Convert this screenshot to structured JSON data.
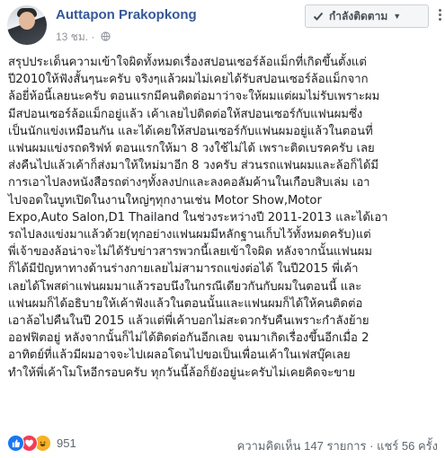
{
  "post": {
    "author": "Auttapon Prakopkong",
    "time": "13 ชม.",
    "privacy_icon": "globe-icon",
    "follow_label": "กำลังติดตาม",
    "body": "สรุปประเด็นความเข้าใจผิดทั้งหมดเรื่องสปอนเซอร์ล้อแม็กที่เกิดขึ้นตั้งแต่\nปี2010ให้ฟังสั้นๆนะครับ จริงๆแล้วผมไม่เคยได้รับสปอนเซอร์ล้อแม็กจาก\nล้อยี่ห้อนี้เลยนะครับ ตอนแรกมีคนติดต่อมาว่าจะให้ผมแต่ผมไม่รับเพราะผม\nมีสปอนเซอร์ล้อแม็กอยู่แล้ว เค้าเลยไปติดต่อให้สปอนเซอร์กับแฟนผมซึ่ง\nเป็นนักแข่งเหมือนกัน และได้เคยให้สปอนเซอร์กับแฟนผมอยู่แล้วในตอนที่\nแฟนผมแข่งรถดริฟท์ ตอนแรกให้มา 8 วงใช้ไม่ได้ เพราะติดเบรคครับ เลย\nส่งคืนไปแล้วเค้าก็ส่งมาให้ใหม่มาอีก 8 วงครับ ส่วนรถแฟนผมและล้อก็ได้มี\nการเอาไปลงหนังสือรถต่างๆทั้งลงปกและลงคอลัมค้านในเกือบสิบเล่ม เอา\nไปจอดในบูทเปิดในงานใหญ่ๆทุกงานเช่น Motor Show,Motor\nExpo,Auto Salon,D1 Thailand ในช่วงระหว่างปี 2011-2013 และได้เอา\nรถไปลงแข่งมาแล้วด้วย(ทุกอย่างแฟนผมมีหลักฐานเก็บไว้ทั้งหมดครับ)แต่\nพี่เจ้าของล้อน่าจะไม่ได้รับข่าวสารพวกนี้เลยเข้าใจผิด หลังจากนั้นแฟนผม\nก็ได้มีปัญหาทางด้านร่างกายเลยไม่สามารถแข่งต่อได้ ในปี2015 พี่เค้า\nเลยได้โพสด่าแฟนผมมาแล้วรอบนึงในกรณีเดียวกันกับผมในตอนนี้ และ\nแฟนผมก็ได้อธิบายให้เค้าฟังแล้วในตอนนั้นและแฟนผมก็ได้ให้คนติดต่อ\nเอาล้อไปคืนในปี 2015 แล้วแต่พี่เค้าบอกไม่สะดวกรับคืนเพราะกำลังย้าย\nออฟฟิตอยู่ หลังจากนั้นก็ไม่ได้ติดต่อกันอีกเลย จนมาเกิดเรื่องขึ้นอีกเมื่อ 2\nอาทิตย์ที่แล้วมีผมอาจจะไปเผลอโดนไปขอเป็นเพื่อนเค้าในเฟสบุ๊คเลย\nทำให้พี่เค้าโมโหอีกรอบครับ ทุกวันนี้ล้อก็ยังอยู่นะครับไม่เคยคิดจะขาย"
  },
  "reactions": {
    "types": [
      "like",
      "love",
      "haha"
    ],
    "count": "951"
  },
  "stats": {
    "comments": "ความคิดเห็น 147 รายการ",
    "shares": "แชร์ 56 ครั้ง"
  },
  "colors": {
    "author": "#365899",
    "meta": "#90949c",
    "like": "#1877f2",
    "love": "#f33e58",
    "haha": "#f7b125"
  }
}
